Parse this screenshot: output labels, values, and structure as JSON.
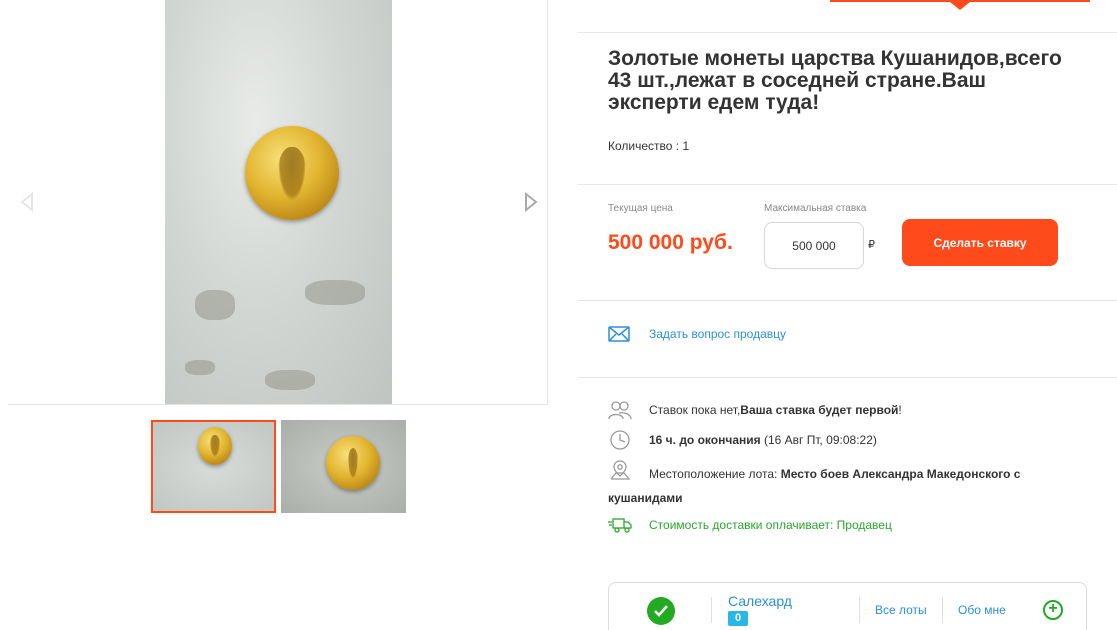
{
  "lot": {
    "title": "Золотые монеты царства Кушанидов,всего 43 шт.,лежат в соседней стране.Ваш эксперти едем туда!",
    "quantity": "Количество : 1"
  },
  "pricing": {
    "current_price_label": "Текущая цена",
    "current_price": "500 000 руб.",
    "max_bid_label": "Максимальная ставка",
    "max_bid_value": "500 000",
    "currency_symbol": "₽",
    "bid_button": "Сделать ставку"
  },
  "ask_seller": "Задать вопрос продавцу",
  "info": {
    "bids_prefix": "Ставок пока нет, ",
    "bids_bold": "Ваша ставка будет первой",
    "bids_suffix": "!",
    "time_bold": "16 ч. до окончания",
    "time_rest": " (16 Авг Пт, 09:08:22)",
    "location_prefix": "Местоположение лота: ",
    "location_bold": "Место боев Александра Македонского с кушанидами",
    "delivery": "Стоимость доставки оплачивает: Продавец"
  },
  "seller": {
    "name": "Салехард",
    "rating": "0",
    "all_lots": "Все лоты",
    "about": "Обо мне"
  },
  "icons": {
    "expand": "expand-icon",
    "prev": "chevron-left-icon",
    "next": "chevron-right-icon",
    "mail": "mail-icon",
    "users": "users-icon",
    "clock": "clock-icon",
    "location": "location-pin-icon",
    "truck": "truck-icon",
    "verified": "check-circle-icon",
    "add": "plus-circle-icon"
  },
  "colors": {
    "accent": "#ff4a1c",
    "link": "#2b8fd6",
    "success": "#22aa22"
  }
}
